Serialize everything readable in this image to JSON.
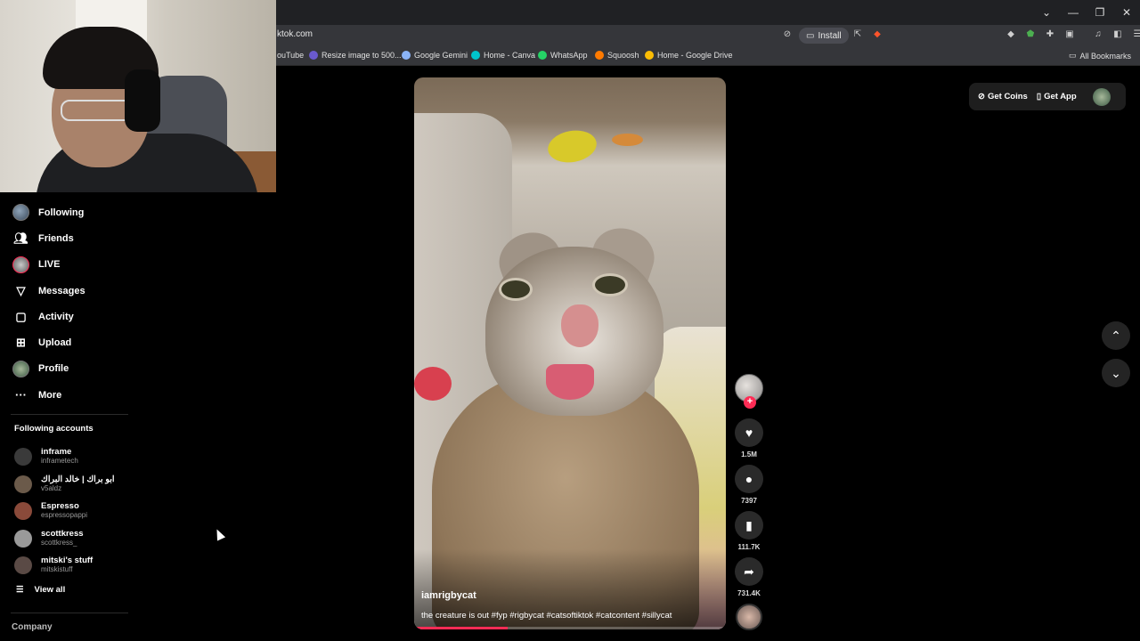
{
  "browser": {
    "url": "tiktok.com",
    "url_display": "ktok.com",
    "install_label": "Install",
    "bookmarks": [
      {
        "label": "YouTube",
        "display": "ouTube",
        "color": "#ff0000"
      },
      {
        "label": "Resize image to 500...",
        "color": "#6a5acd"
      },
      {
        "label": "Google Gemini",
        "color": "#8ab4f8"
      },
      {
        "label": "Home - Canva",
        "color": "#00c4cc"
      },
      {
        "label": "WhatsApp",
        "color": "#25d366"
      },
      {
        "label": "Squoosh",
        "color": "#ff7a00"
      },
      {
        "label": "Home - Google Drive",
        "color": "#fbbc04"
      }
    ],
    "all_bookmarks_label": "All Bookmarks"
  },
  "sidebar": {
    "items": [
      {
        "label": "Following",
        "icon": "following-avatar-icon"
      },
      {
        "label": "Friends",
        "icon": "friends-icon"
      },
      {
        "label": "LIVE",
        "icon": "live-icon"
      },
      {
        "label": "Messages",
        "icon": "messages-icon"
      },
      {
        "label": "Activity",
        "icon": "activity-icon"
      },
      {
        "label": "Upload",
        "icon": "upload-icon"
      },
      {
        "label": "Profile",
        "icon": "profile-avatar-icon"
      },
      {
        "label": "More",
        "icon": "more-icon"
      }
    ],
    "following_accounts_title": "Following accounts",
    "accounts": [
      {
        "name": "inframe",
        "handle": "inframetech",
        "color": "#3a3a3a"
      },
      {
        "name": "ابو براك | خالد البراك",
        "handle": "v5aldz",
        "color": "#6b5a4a"
      },
      {
        "name": "Espresso",
        "handle": "espressopappi",
        "color": "#8a4a3a"
      },
      {
        "name": "scottkress",
        "handle": "scottkress_",
        "color": "#9a9a9a"
      },
      {
        "name": "mitski's stuff",
        "handle": "mitskistuff",
        "color": "#5a4a45"
      }
    ],
    "view_all_label": "View all",
    "company_label": "Company"
  },
  "video": {
    "username": "iamrigbycat",
    "caption": "the creature is out #fyp #rigbycat #catsoftiktok #catcontent #sillycat",
    "progress": 0.3
  },
  "actions": {
    "likes": "1.5M",
    "comments": "7397",
    "saves": "111.7K",
    "shares": "731.4K"
  },
  "topbar": {
    "get_coins_label": "Get Coins",
    "get_app_label": "Get App"
  },
  "colors": {
    "brand_red": "#fe2c55",
    "background": "#000000"
  }
}
